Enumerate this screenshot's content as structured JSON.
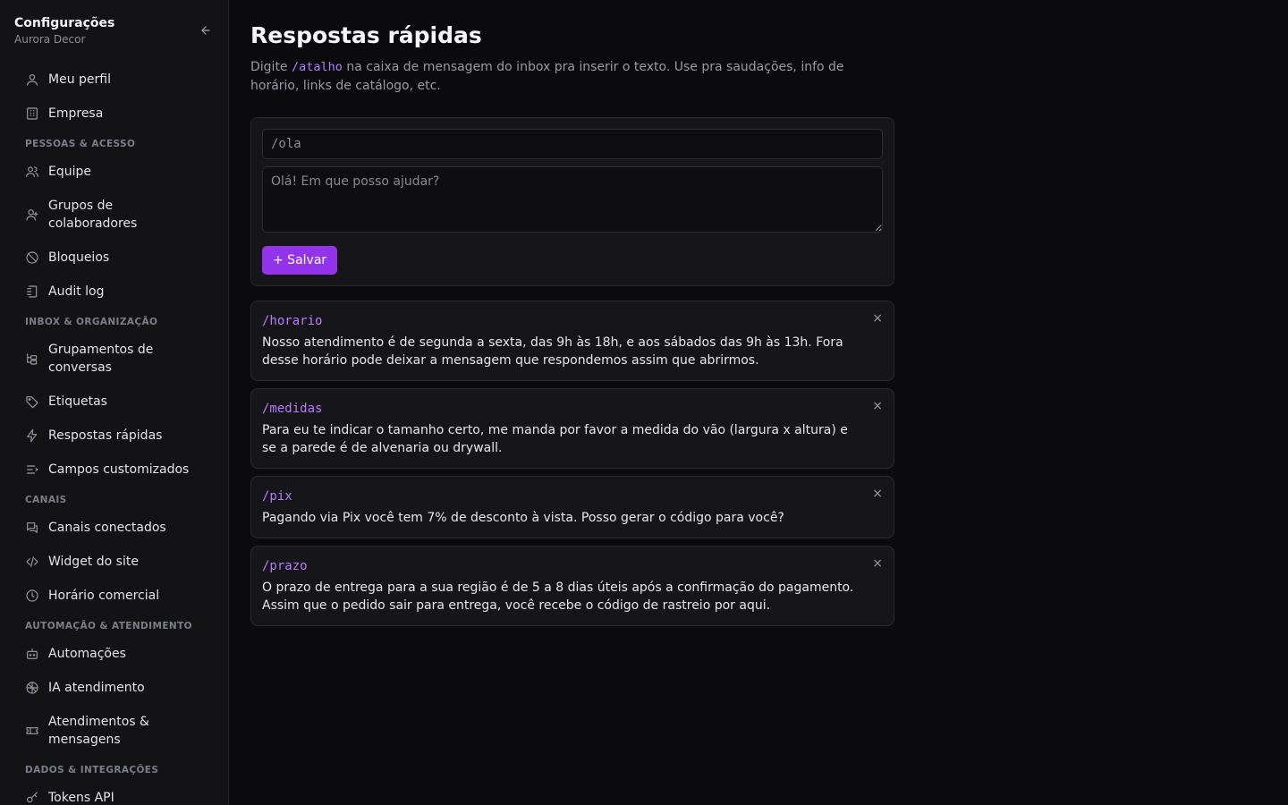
{
  "sidebar": {
    "title": "Configurações",
    "subtitle": "Aurora Decor",
    "items": [
      {
        "type": "item",
        "name": "meu-perfil",
        "label": "Meu perfil",
        "icon": "user-icon"
      },
      {
        "type": "item",
        "name": "empresa",
        "label": "Empresa",
        "icon": "building-icon"
      },
      {
        "type": "section",
        "label": "PESSOAS & ACESSO"
      },
      {
        "type": "item",
        "name": "equipe",
        "label": "Equipe",
        "icon": "users-icon"
      },
      {
        "type": "item",
        "name": "grupos",
        "label": "Grupos de colaboradores",
        "icon": "user-group-icon"
      },
      {
        "type": "item",
        "name": "bloqueios",
        "label": "Bloqueios",
        "icon": "ban-icon"
      },
      {
        "type": "item",
        "name": "audit-log",
        "label": "Audit log",
        "icon": "log-icon"
      },
      {
        "type": "section",
        "label": "INBOX & ORGANIZAÇÃO"
      },
      {
        "type": "item",
        "name": "grupamentos",
        "label": "Grupamentos de conversas",
        "icon": "tree-icon"
      },
      {
        "type": "item",
        "name": "etiquetas",
        "label": "Etiquetas",
        "icon": "tag-icon"
      },
      {
        "type": "item",
        "name": "respostas-rapidas",
        "label": "Respostas rápidas",
        "icon": "zap-icon",
        "active": true
      },
      {
        "type": "item",
        "name": "campos",
        "label": "Campos customizados",
        "icon": "list-icon"
      },
      {
        "type": "section",
        "label": "CANAIS"
      },
      {
        "type": "item",
        "name": "canais",
        "label": "Canais conectados",
        "icon": "chat-icon"
      },
      {
        "type": "item",
        "name": "widget",
        "label": "Widget do site",
        "icon": "code-icon"
      },
      {
        "type": "item",
        "name": "horario",
        "label": "Horário comercial",
        "icon": "clock-icon"
      },
      {
        "type": "section",
        "label": "AUTOMAÇÃO & ATENDIMENTO"
      },
      {
        "type": "item",
        "name": "automacoes",
        "label": "Automações",
        "icon": "bot-icon"
      },
      {
        "type": "item",
        "name": "ia",
        "label": "IA atendimento",
        "icon": "brain-icon"
      },
      {
        "type": "item",
        "name": "atendimentos",
        "label": "Atendimentos & mensagens",
        "icon": "ticket-icon"
      },
      {
        "type": "section",
        "label": "DADOS & INTEGRAÇÕES"
      },
      {
        "type": "item",
        "name": "tokens",
        "label": "Tokens API",
        "icon": "key-icon"
      }
    ]
  },
  "page": {
    "title": "Respostas rápidas",
    "desc_before": "Digite ",
    "desc_code": "/atalho",
    "desc_after": " na caixa de mensagem do inbox pra inserir o texto. Use pra saudações, info de horário, links de catálogo, etc."
  },
  "form": {
    "shortcut_placeholder": "/ola",
    "text_placeholder": "Olá! Em que posso ajudar?",
    "save_label": "+ Salvar"
  },
  "replies": [
    {
      "shortcut": "/horario",
      "text": "Nosso atendimento é de segunda a sexta, das 9h às 18h, e aos sábados das 9h às 13h. Fora desse horário pode deixar a mensagem que respondemos assim que abrirmos."
    },
    {
      "shortcut": "/medidas",
      "text": "Para eu te indicar o tamanho certo, me manda por favor a medida do vão (largura x altura) e se a parede é de alvenaria ou drywall."
    },
    {
      "shortcut": "/pix",
      "text": "Pagando via Pix você tem 7% de desconto à vista. Posso gerar o código para você?"
    },
    {
      "shortcut": "/prazo",
      "text": "O prazo de entrega para a sua região é de 5 a 8 dias úteis após a confirmação do pagamento. Assim que o pedido sair para entrega, você recebe o código de rastreio por aqui."
    }
  ],
  "delete_glyph": "×",
  "colors": {
    "accent": "#9333ea",
    "shortcut": "#b47cff",
    "bg": "#0b0b0d",
    "sidebar": "#131316"
  }
}
